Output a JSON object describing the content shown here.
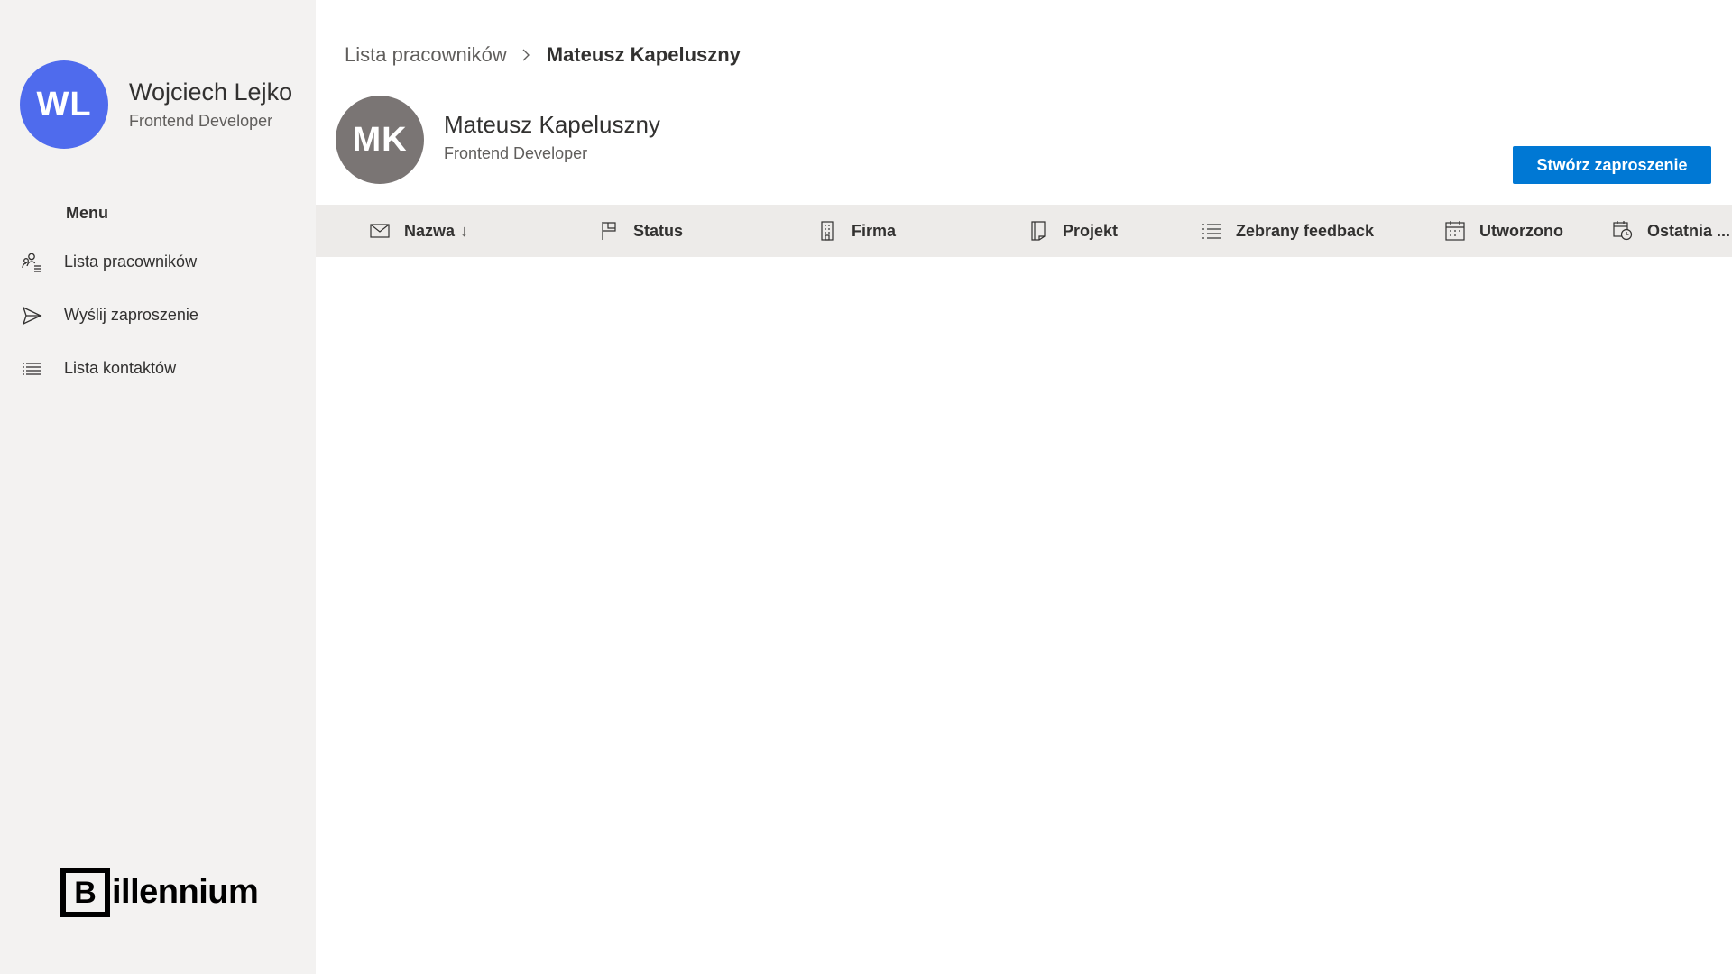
{
  "colors": {
    "sidebar_bg": "#f3f2f1",
    "accent": "#0078d4",
    "user_avatar": "#4f6bed",
    "persona_avatar": "#7a7574",
    "header_bg": "#edebe9"
  },
  "sidebar": {
    "user": {
      "initials": "WL",
      "name": "Wojciech Lejko",
      "role": "Frontend Developer"
    },
    "menu_title": "Menu",
    "items": [
      {
        "label": "Lista pracowników",
        "icon": "people-list-icon"
      },
      {
        "label": "Wyślij zaproszenie",
        "icon": "send-icon"
      },
      {
        "label": "Lista kontaktów",
        "icon": "bulleted-list-icon"
      }
    ],
    "logo": {
      "mark": "B",
      "text": "illennium"
    }
  },
  "breadcrumb": {
    "parent": "Lista pracowników",
    "current": "Mateusz Kapeluszny"
  },
  "persona": {
    "initials": "MK",
    "name": "Mateusz Kapeluszny",
    "role": "Frontend Developer"
  },
  "actions": {
    "create_invitation": "Stwórz zaproszenie"
  },
  "table": {
    "columns": [
      {
        "label": "Nazwa",
        "icon": "mail-icon",
        "sort": "↓"
      },
      {
        "label": "Status",
        "icon": "flag-icon"
      },
      {
        "label": "Firma",
        "icon": "building-icon"
      },
      {
        "label": "Projekt",
        "icon": "document-icon"
      },
      {
        "label": "Zebrany feedback",
        "icon": "checklist-icon"
      },
      {
        "label": "Utworzono",
        "icon": "calendar-icon"
      },
      {
        "label": "Ostatnia ...",
        "icon": "calendar-clock-icon"
      }
    ],
    "rows": []
  }
}
